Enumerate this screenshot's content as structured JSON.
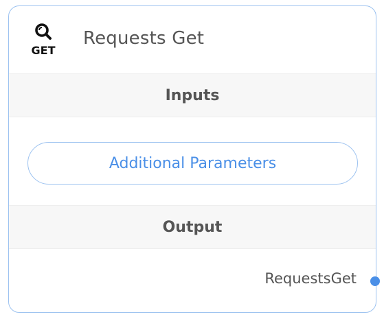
{
  "node": {
    "title": "Requests Get",
    "icon": "search-get-icon",
    "icon_text": "GET"
  },
  "inputs": {
    "header": "Inputs",
    "button_label": "Additional Parameters"
  },
  "output": {
    "header": "Output",
    "label": "RequestsGet"
  },
  "colors": {
    "accent": "#4a8fe7",
    "border": "#9cc2f0",
    "section_bg": "#f7f7f7",
    "text": "#555555"
  }
}
